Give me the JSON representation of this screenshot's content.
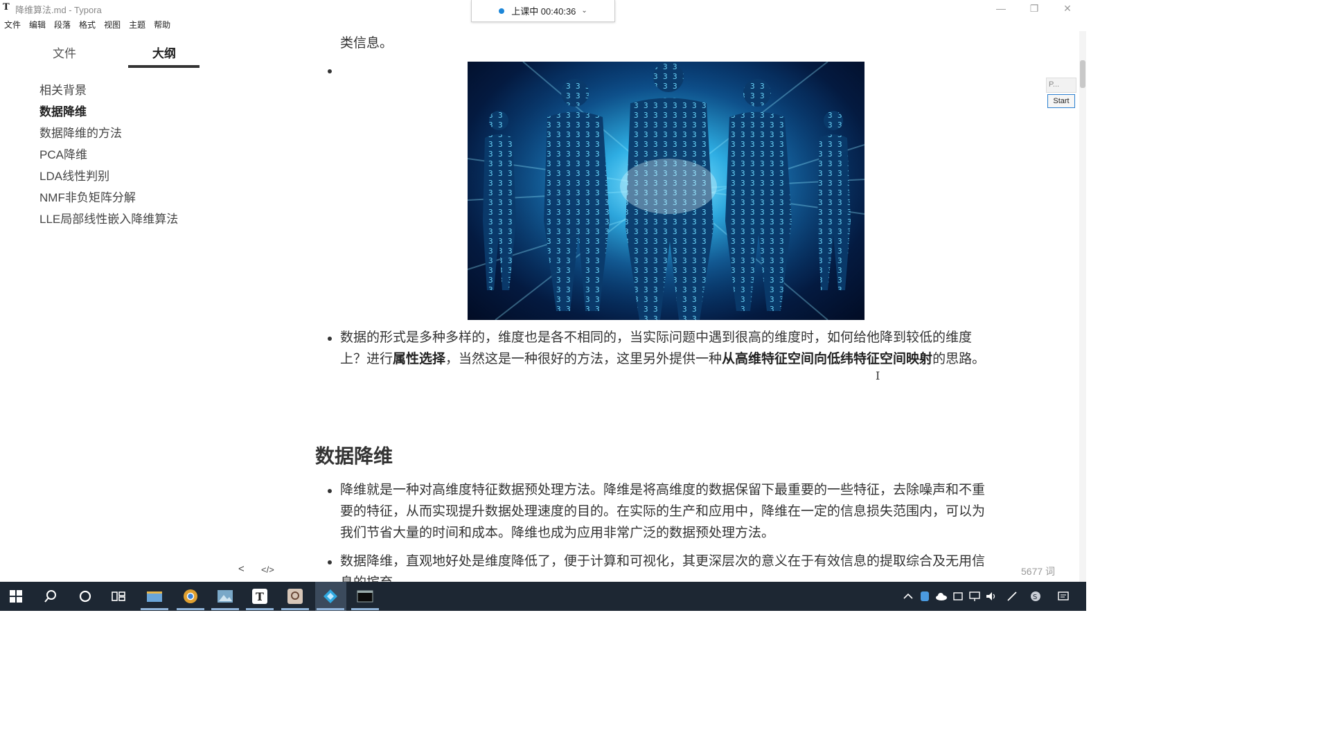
{
  "window": {
    "title": "降维算法.md - Typora",
    "app_icon": "T"
  },
  "menu": [
    "文件",
    "编辑",
    "段落",
    "格式",
    "视图",
    "主题",
    "帮助"
  ],
  "timer": {
    "label": "上课中 00:40:36"
  },
  "sidebar": {
    "tabs": [
      {
        "label": "文件",
        "active": false
      },
      {
        "label": "大纲",
        "active": true
      }
    ],
    "outline": [
      {
        "label": "相关背景",
        "active": false
      },
      {
        "label": "数据降维",
        "active": true
      },
      {
        "label": "数据降维的方法",
        "active": false
      },
      {
        "label": "PCA降维",
        "active": false
      },
      {
        "label": "LDA线性判别",
        "active": false
      },
      {
        "label": "NMF非负矩阵分解",
        "active": false
      },
      {
        "label": "LLE局部线性嵌入降维算法",
        "active": false
      }
    ],
    "footer": {
      "back": "<",
      "source": "</>"
    }
  },
  "content": {
    "top_text": "类信息。",
    "bullet1": {
      "part1": "数据的形式是多种多样的，维度也是各不相同的，当实际问题中遇到很高的维度时，如何给他降到较低的维度上？进行",
      "bold1": "属性选择",
      "part2": "，当然这是一种很好的方法，这里另外提供一种",
      "bold2": "从高维特征空间向低纬特征空间映射",
      "part3": "的思路。"
    },
    "heading": "数据降维",
    "bullet2": "降维就是一种对高维度特征数据预处理方法。降维是将高维度的数据保留下最重要的一些特征，去除噪声和不重要的特征，从而实现提升数据处理速度的目的。在实际的生产和应用中，降维在一定的信息损失范围内，可以为我们节省大量的时间和成本。降维也成为应用非常广泛的数据预处理方法。",
    "bullet3": "数据降维，直观地好处是维度降低了，便于计算和可视化，其更深层次的意义在于有效信息的提取综合及无用信息的摈弃"
  },
  "status": {
    "word_count": "5677 词"
  },
  "float_widget": {
    "label": "P...",
    "button": "Start"
  },
  "colors": {
    "accent": "#1c86d8",
    "taskbar": "#1d2733"
  }
}
